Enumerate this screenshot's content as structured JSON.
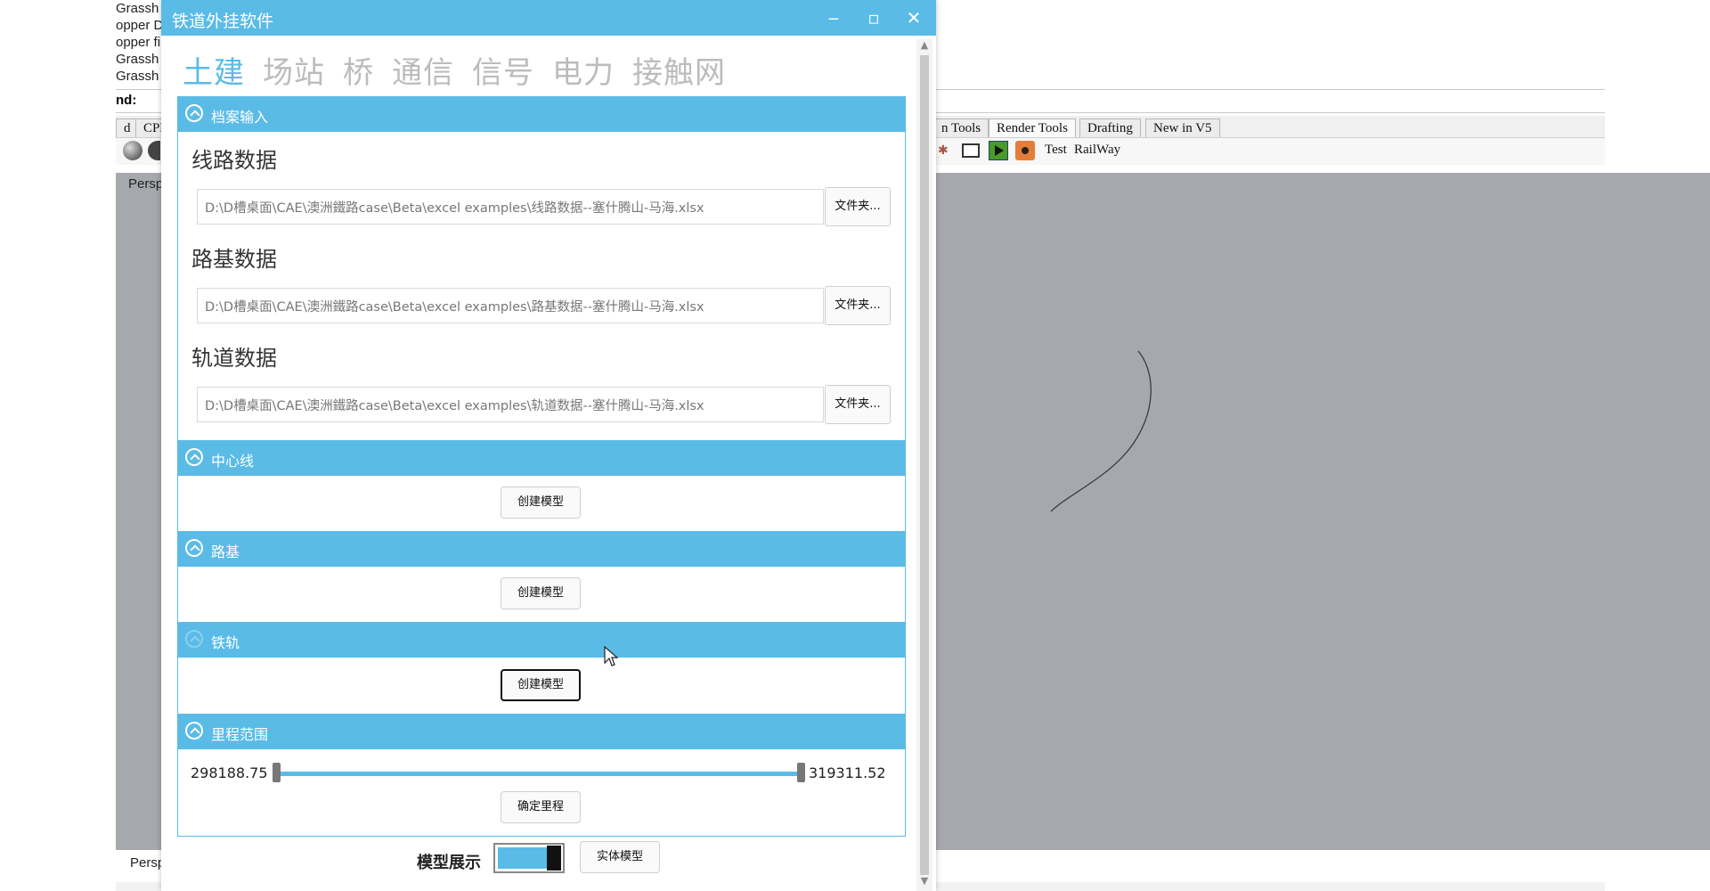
{
  "background_app": {
    "command_history": [
      "Grassh",
      "opper Do",
      "opper file",
      "Grassh",
      "Grassh"
    ],
    "command_label": "nd:",
    "left_tabs": [
      "d",
      "CPl"
    ],
    "toolbar_tabs": [
      {
        "label": "n Tools",
        "active": false
      },
      {
        "label": "Render Tools",
        "active": true
      },
      {
        "label": "Drafting",
        "active": false
      },
      {
        "label": "New in V5",
        "active": false
      }
    ],
    "toolbar_text_1": "Test",
    "toolbar_text_2": "RailWay",
    "viewport_top_label": "Persp",
    "viewport_bottom_label": "Persp"
  },
  "window": {
    "title": "铁道外挂软件",
    "minimize": "‒",
    "maximize": "▫",
    "close": "✕"
  },
  "nav_tabs": [
    "土建",
    "场站",
    "桥",
    "通信",
    "信号",
    "电力",
    "接触网"
  ],
  "active_nav": "土建",
  "sections": {
    "archive": {
      "header": "档案输入",
      "fields": [
        {
          "title": "线路数据",
          "path": "D:\\D槽桌面\\CAE\\澳洲鐵路case\\Beta\\excel examples\\线路数据--塞什腾山-马海.xlsx",
          "button": "文件夹..."
        },
        {
          "title": "路基数据",
          "path": "D:\\D槽桌面\\CAE\\澳洲鐵路case\\Beta\\excel examples\\路基数据--塞什腾山-马海.xlsx",
          "button": "文件夹..."
        },
        {
          "title": "轨道数据",
          "path": "D:\\D槽桌面\\CAE\\澳洲鐵路case\\Beta\\excel examples\\轨道数据--塞什腾山-马海.xlsx",
          "button": "文件夹..."
        }
      ]
    },
    "centerline": {
      "header": "中心线",
      "button": "创建模型"
    },
    "roadbed": {
      "header": "路基",
      "button": "创建模型"
    },
    "rail": {
      "header": "铁轨",
      "button": "创建模型"
    },
    "mileage": {
      "header": "里程范围",
      "min": "298188.75",
      "max": "319311.52",
      "range_low_fraction": 0.0,
      "range_high_fraction": 1.0,
      "button": "确定里程"
    }
  },
  "bottom": {
    "label": "模型展示",
    "toggle_on": true,
    "button": "实体模型"
  },
  "colors": {
    "accent": "#5abbe7",
    "viewport": "#a6a8ad"
  }
}
